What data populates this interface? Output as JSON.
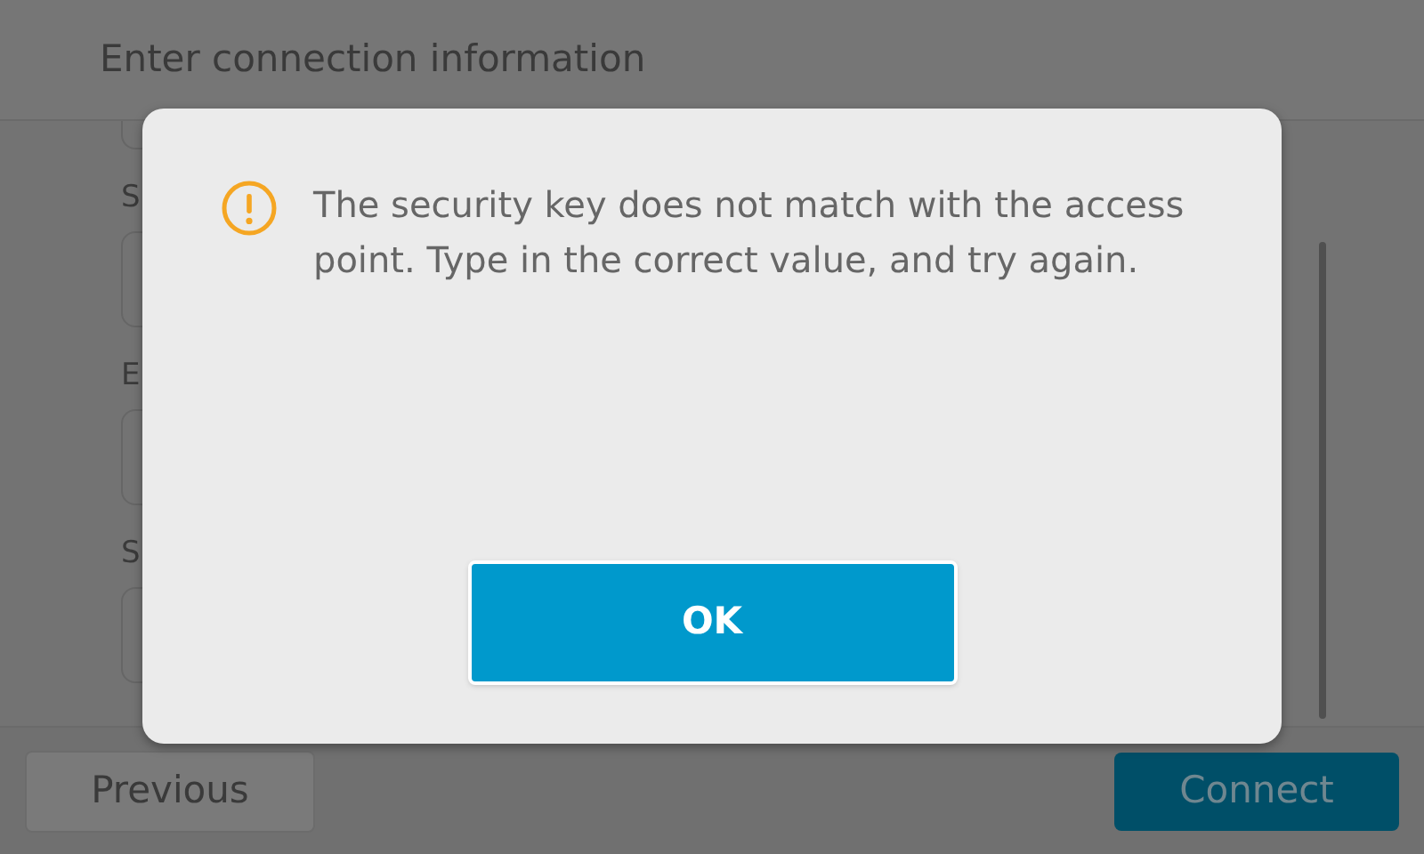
{
  "header": {
    "title": "Enter connection information"
  },
  "fields": [
    {
      "label": "S"
    },
    {
      "label": "E"
    },
    {
      "label": "S"
    }
  ],
  "footer": {
    "buttons": [
      {
        "label": "Previous",
        "kind": "secondary"
      },
      {
        "label": "Connect",
        "kind": "primary"
      }
    ]
  },
  "dialog": {
    "kind": "warning",
    "message": "The security key does not match with the access point. Type in the correct value, and try again.",
    "button": "OK"
  }
}
